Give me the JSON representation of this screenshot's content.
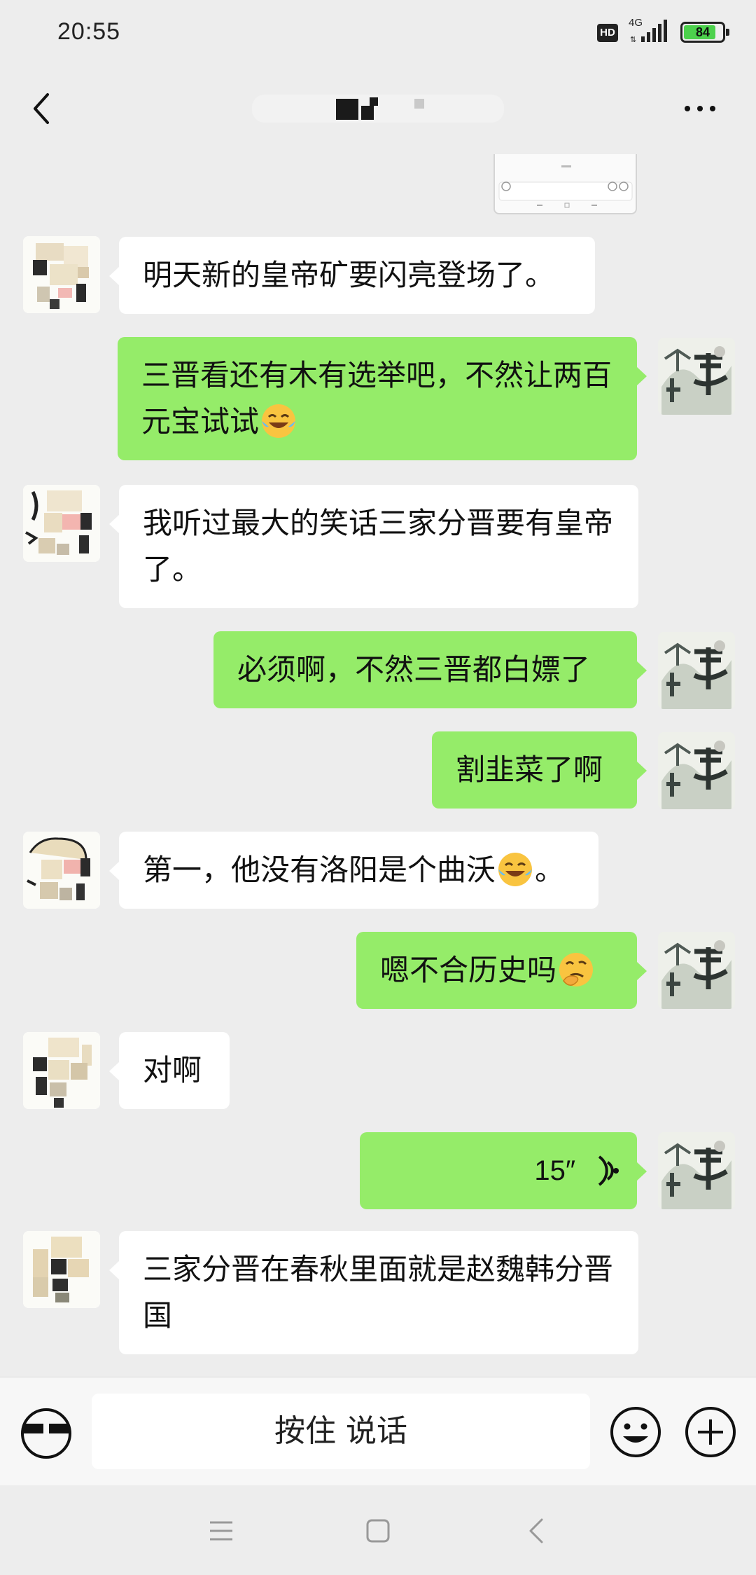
{
  "status_bar": {
    "time": "20:55",
    "hd": "HD",
    "network": "4G",
    "battery": "84",
    "battery_level": 0.84
  },
  "header": {
    "title": "",
    "title_obscured": true
  },
  "input_bar": {
    "hold_to_talk": "按住 说话"
  },
  "messages": [
    {
      "side": "left",
      "text": "明天新的皇帝矿要闪亮登场了。"
    },
    {
      "side": "right",
      "text": "三晋看还有木有选举吧，不然让两百元宝试试",
      "emoji": "crying-laughing"
    },
    {
      "side": "left",
      "text": "我听过最大的笑话三家分晋要有皇帝了。"
    },
    {
      "side": "right",
      "text": "必须啊，不然三晋都白嫖了"
    },
    {
      "side": "right",
      "text": "割韭菜了啊"
    },
    {
      "side": "left",
      "text": "第一，他没有洛阳是个曲沃",
      "emoji": "crying-laughing",
      "suffix": "。"
    },
    {
      "side": "right",
      "text": "嗯不合历史吗",
      "emoji": "thinking"
    },
    {
      "side": "left",
      "text": "对啊"
    },
    {
      "side": "right",
      "type": "voice",
      "duration": "15″"
    },
    {
      "side": "left",
      "text": "三家分晋在春秋里面就是赵魏韩分晋国"
    }
  ],
  "colors": {
    "background": "#ededed",
    "bubble_sent": "#95ec69",
    "bubble_received": "#ffffff"
  },
  "icons": {
    "back": "chevron-left-icon",
    "more": "more-dots-icon",
    "voice_toggle": "voice-mode-icon",
    "emoji": "emoji-icon",
    "plus": "plus-circle-icon",
    "sys_menu": "menu-icon",
    "sys_home": "home-square-icon",
    "sys_back": "back-triangle-icon"
  }
}
